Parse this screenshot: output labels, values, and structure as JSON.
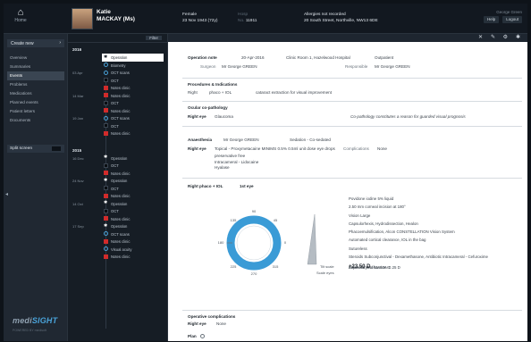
{
  "header": {
    "home_label": "Home",
    "patient_first": "Katie",
    "patient_last": "MACKAY (Ms)",
    "sex": "Female",
    "dob": "23 Nov 1943 (72y)",
    "hosp_label": "Hosp",
    "id_label": "No.",
    "id_value": "11911",
    "allergies": "Allergies not recorded",
    "address": "20 South Street, Northville, NW13 6DE",
    "right_top": "George Green",
    "btn1": "Help",
    "btn2": "Logout"
  },
  "nav": {
    "create_label": "Create new",
    "items": [
      {
        "label": "Overview"
      },
      {
        "label": "Summaries"
      },
      {
        "label": "Events"
      },
      {
        "label": "Problems"
      },
      {
        "label": "Medications"
      },
      {
        "label": "Planned events"
      },
      {
        "label": "Patient letters"
      },
      {
        "label": "Documents"
      }
    ],
    "split_label": "Split screen",
    "brand_a": "medi",
    "brand_b": "SIGHT",
    "powered": "POWERED BY medisoft"
  },
  "timeline": {
    "filter_label": "Filter",
    "year1": "2016",
    "year2": "2015",
    "rows1": [
      {
        "date": "20 Apr",
        "icon": "star",
        "label": "Operation",
        "sel": true
      },
      {
        "date": "",
        "icon": "blue",
        "label": "Biometry"
      },
      {
        "date": "03 Apr",
        "icon": "blue",
        "label": "OCT scans"
      },
      {
        "date": "",
        "icon": "dark",
        "label": "OCT"
      },
      {
        "date": "",
        "icon": "red",
        "label": "Notes clinic"
      },
      {
        "date": "14 Mar",
        "icon": "red",
        "label": "Notes clinic"
      },
      {
        "date": "",
        "icon": "dark",
        "label": "OCT"
      },
      {
        "date": "",
        "icon": "red",
        "label": "Notes clinic"
      },
      {
        "date": "19 Jan",
        "icon": "blue",
        "label": "OCT scans"
      },
      {
        "date": "",
        "icon": "dark",
        "label": "OCT"
      },
      {
        "date": "",
        "icon": "red",
        "label": "Notes clinic"
      }
    ],
    "rows2": [
      {
        "date": "16 Dec",
        "icon": "star",
        "label": "Operation"
      },
      {
        "date": "",
        "icon": "dark",
        "label": "OCT"
      },
      {
        "date": "",
        "icon": "red",
        "label": "Notes clinic"
      },
      {
        "date": "24 Nov",
        "icon": "star",
        "label": "Operation"
      },
      {
        "date": "",
        "icon": "dark",
        "label": "OCT"
      },
      {
        "date": "",
        "icon": "red",
        "label": "Notes clinic"
      },
      {
        "date": "14 Oct",
        "icon": "star",
        "label": "Operation"
      },
      {
        "date": "",
        "icon": "dark",
        "label": "OCT"
      },
      {
        "date": "",
        "icon": "red",
        "label": "Notes clinic"
      },
      {
        "date": "17 Sep",
        "icon": "star",
        "label": "Operation"
      },
      {
        "date": "",
        "icon": "blue",
        "label": "OCT scans"
      },
      {
        "date": "",
        "icon": "red",
        "label": "Notes clinic"
      },
      {
        "date": "",
        "icon": "blue",
        "label": "Visual acuity"
      },
      {
        "date": "",
        "icon": "red",
        "label": "Notes clinic"
      }
    ]
  },
  "note": {
    "op_title": "Operation note",
    "op_date": "20-Apr-2016",
    "op_place": "Clinic Room 1, Hazelwood Hospital",
    "op_type": "Outpatient",
    "surgeon_label": "Surgeon",
    "surgeon": "Mr George GREEN",
    "resp_label": "Responsible",
    "resp": "Mr George GREEN",
    "proc_title": "Procedures & Indications",
    "proc_eye": "Right",
    "proc_name": "phaco + IOL",
    "proc_ind": "cataract extraction for visual improvement",
    "ocular_title": "Ocular co-pathology",
    "ocular_eye": "Right eye",
    "ocular_cond": "Glaucoma",
    "ocular_note": "Co-pathology constitutes a reason for guarded visual prognosis",
    "anaes_title": "Anaesthesia",
    "anaes_by": "Mr George GREEN",
    "sedation": "Sedation - Co-sedated",
    "anaes_eye": "Right eye",
    "anaes_1": "Topical - Proxymetacaine MINIMS 0.5% 0.5ml unit dose eye drops",
    "anaes_2": "preservative free",
    "anaes_3": "Intracameral - Lidocaine",
    "anaes_4": "Hyalase",
    "comp_label": "Complications",
    "comp_value": "None",
    "iol_title": "Right phaco + IOL",
    "iol_sub": "1st eye",
    "angles": [
      "90",
      "135",
      "45",
      "180",
      "0",
      "225",
      "270",
      "315"
    ],
    "tag_a": "Tilt scale",
    "tag_b": "Scale eyes",
    "details": [
      "Povidone iodine 5% liquid",
      "2.50 mm corneal incision at 180°",
      "Vision Large",
      "Capsulorhexis, Hydrodissection, Healon",
      "Phacoemulsification, Alcon CONSTELLATION Vision System",
      "Automated cortical clearance, IOL in the bag",
      "Sutureless",
      "Steroids Subconjunctival - Dexamethasone, Antibiotic Intracameral - Cefuroxime"
    ],
    "lens_power": "+23.50 D",
    "lens_model": "Alcon AcrySof MA60AC",
    "refraction": "Expected R refraction -0.25 D",
    "postop_title": "Operative complications",
    "postop_eye": "Right eye",
    "postop_value": "None",
    "plan_label": "Plan"
  },
  "colors": {
    "accent": "#4aa3d9",
    "alert": "#d12b2b"
  }
}
